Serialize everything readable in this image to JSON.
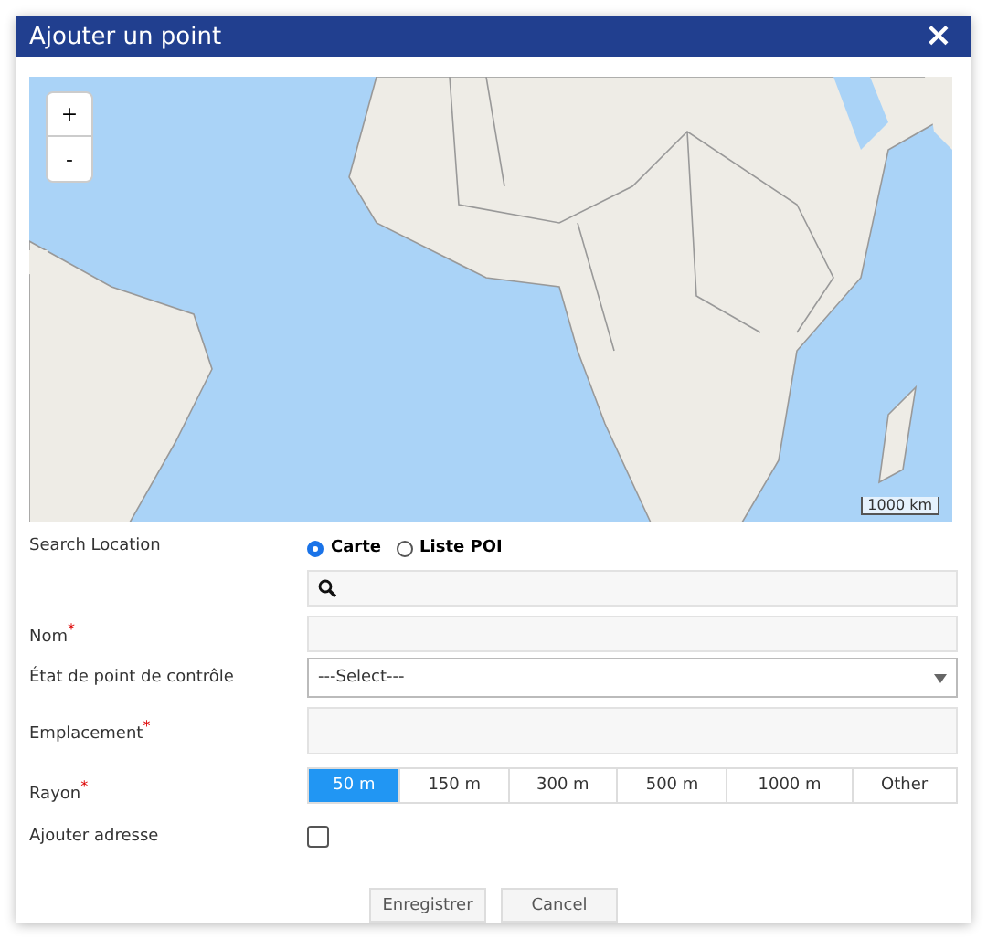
{
  "window": {
    "title": "Ajouter un point",
    "close": "×"
  },
  "map": {
    "zoom_in": "+",
    "zoom_out": "-",
    "scale": "1000 km"
  },
  "form": {
    "search_location": {
      "label": "Search Location",
      "options": [
        {
          "label": "Carte",
          "selected": true
        },
        {
          "label": "Liste POI",
          "selected": false
        }
      ]
    },
    "nom": {
      "label": "Nom",
      "required_mark": "*"
    },
    "etat": {
      "label": "État de point de contrôle",
      "value": "---Select---"
    },
    "emplacement": {
      "label": "Emplacement",
      "required_mark": "*"
    },
    "rayon": {
      "label": "Rayon",
      "required_mark": "*",
      "options": [
        {
          "label": "50 m",
          "selected": true
        },
        {
          "label": "150 m",
          "selected": false
        },
        {
          "label": "300 m",
          "selected": false
        },
        {
          "label": "500 m",
          "selected": false
        },
        {
          "label": "1000 m",
          "selected": false
        },
        {
          "label": "Other",
          "selected": false
        }
      ]
    },
    "ajouter_adresse": {
      "label": "Ajouter adresse",
      "checked": false
    }
  },
  "buttons": [
    "Enregistrer",
    "Cancel"
  ]
}
